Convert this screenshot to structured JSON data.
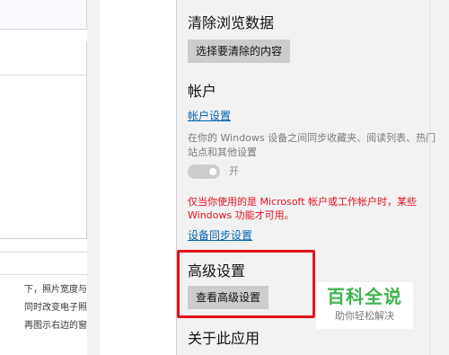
{
  "left_page": {
    "text_lines": [
      "下，照片宽度与",
      "同时改变电子照",
      "再图示右边的窗"
    ]
  },
  "settings": {
    "clear_data": {
      "heading": "清除浏览数据",
      "button": "选择要清除的内容"
    },
    "account": {
      "heading": "帐户",
      "link": "帐户设置",
      "description": "在你的 Windows 设备之间同步收藏夹、阅读列表、热门站点和其他设置",
      "toggle_state": "开",
      "warning": "仅当你使用的是 Microsoft 帐户或工作帐户时，某些 Windows 功能才可用。",
      "sync_link": "设备同步设置"
    },
    "advanced": {
      "heading": "高级设置",
      "button": "查看高级设置"
    },
    "about": {
      "heading": "关于此应用"
    }
  },
  "watermark": {
    "title": "百科全说",
    "subtitle": "助你轻松解决"
  },
  "colors": {
    "link": "#0063b1",
    "warning": "#e81123",
    "highlight": "#e4131b",
    "watermark_green": "#3cb64a"
  }
}
